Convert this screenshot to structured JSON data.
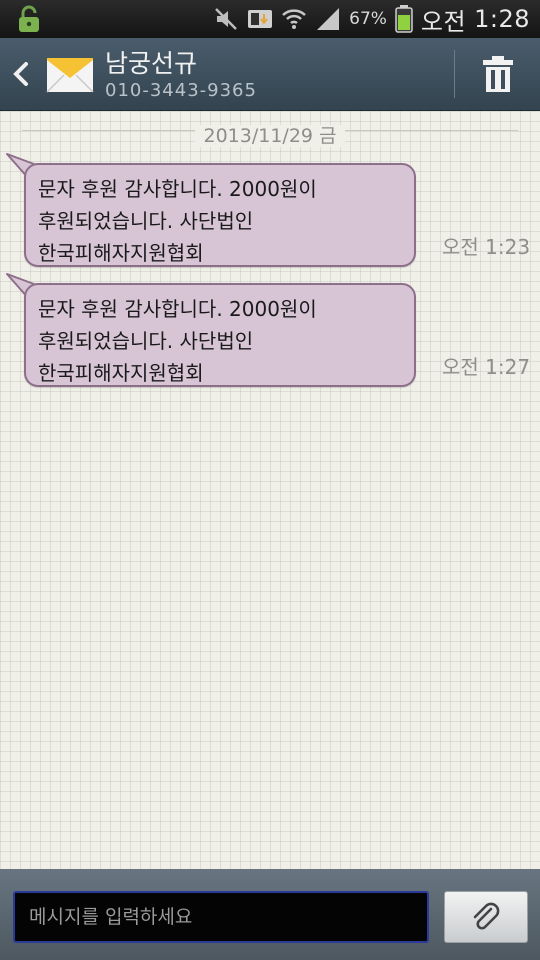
{
  "status_bar": {
    "battery_percent": "67%",
    "period": "오전",
    "time": "1:28"
  },
  "header": {
    "contact_name": "남궁선규",
    "phone": "010-3443-9365"
  },
  "conversation": {
    "date": "2013/11/29 금",
    "messages": [
      {
        "lines": [
          "문자 후원 감사합니다. 2000원이",
          "후원되었습니다. 사단법인",
          "한국피해자지원협회"
        ],
        "time": "오전 1:23"
      },
      {
        "lines": [
          "문자 후원 감사합니다. 2000원이",
          "후원되었습니다. 사단법인",
          "한국피해자지원협회"
        ],
        "time": "오전 1:27"
      }
    ]
  },
  "composer": {
    "placeholder": "메시지를 입력하세요"
  },
  "icons": {
    "status_left": "unlock-icon",
    "status_right": [
      "mute-icon",
      "data-sync-icon",
      "wifi-icon",
      "signal-icon",
      "battery-icon"
    ],
    "header": [
      "back-icon",
      "envelope-icon",
      "trash-icon"
    ],
    "composer": "paperclip-icon"
  }
}
